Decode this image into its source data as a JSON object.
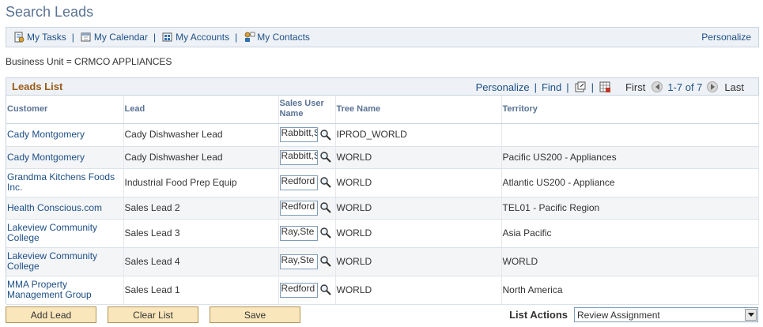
{
  "page": {
    "title": "Search Leads",
    "business_unit": "Business Unit = CRMCO APPLIANCES"
  },
  "nav": {
    "items": [
      {
        "label": "My Tasks",
        "icon": "tasks-icon"
      },
      {
        "label": "My Calendar",
        "icon": "calendar-icon"
      },
      {
        "label": "My Accounts",
        "icon": "accounts-icon"
      },
      {
        "label": "My Contacts",
        "icon": "contacts-icon"
      }
    ],
    "personalize": "Personalize"
  },
  "grid": {
    "title": "Leads List",
    "personalize": "Personalize",
    "find": "Find",
    "first": "First",
    "range": "1-7 of 7",
    "last": "Last",
    "columns": {
      "customer": "Customer",
      "lead": "Lead",
      "sales_user": "Sales User Name",
      "tree": "Tree Name",
      "territory": "Territory"
    },
    "rows": [
      {
        "customer": "Cady Montgomery",
        "lead": "Cady Dishwasher Lead",
        "sales_user": "Rabbitt,S",
        "tree": "IPROD_WORLD",
        "territory": ""
      },
      {
        "customer": "Cady Montgomery",
        "lead": "Cady Dishwasher Lead",
        "sales_user": "Rabbitt,S",
        "tree": "WORLD",
        "territory": "Pacific US200 - Appliances"
      },
      {
        "customer": "Grandma Kitchens Foods Inc.",
        "lead": "Industrial Food Prep Equip",
        "sales_user": "Redford",
        "tree": "WORLD",
        "territory": "Atlantic US200 - Appliance"
      },
      {
        "customer": "Health Conscious.com",
        "lead": "Sales Lead 2",
        "sales_user": "Redford",
        "tree": "WORLD",
        "territory": "TEL01 - Pacific Region"
      },
      {
        "customer": "Lakeview Community College",
        "lead": "Sales Lead 3",
        "sales_user": "Ray,Ste",
        "tree": "WORLD",
        "territory": "Asia Pacific"
      },
      {
        "customer": "Lakeview Community College",
        "lead": "Sales Lead 4",
        "sales_user": "Ray,Ste",
        "tree": "WORLD",
        "territory": "WORLD"
      },
      {
        "customer": "MMA Property Management Group",
        "lead": "Sales Lead 1",
        "sales_user": "Redford",
        "tree": "WORLD",
        "territory": "North America"
      }
    ]
  },
  "buttons": {
    "add_lead": "Add Lead",
    "clear_list": "Clear List",
    "save": "Save"
  },
  "list_actions": {
    "label": "List Actions",
    "selected": "Review Assignment"
  },
  "colors": {
    "link": "#1e4f86",
    "title": "#5a7394",
    "grid_title": "#9c5b18",
    "button_bg": "#f9e6bb"
  }
}
